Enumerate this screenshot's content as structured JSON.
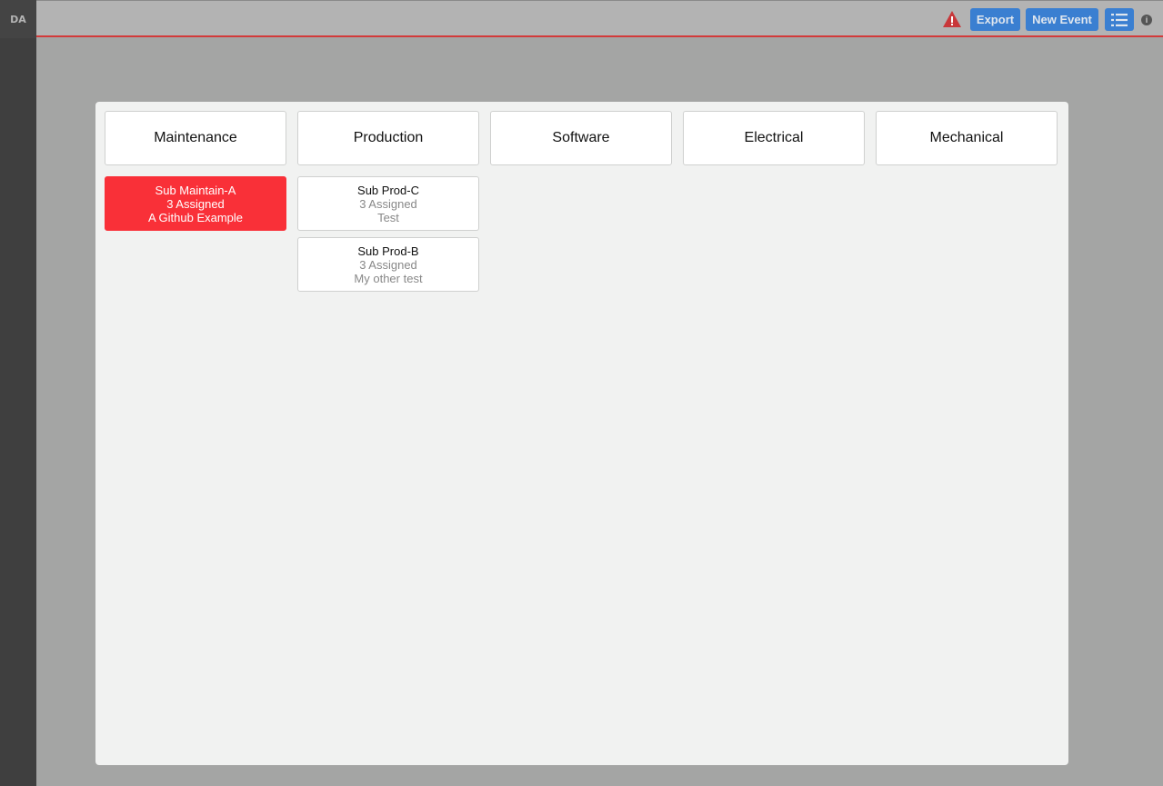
{
  "app": {
    "logo": "DA"
  },
  "toolbar": {
    "export_label": "Export",
    "new_event_label": "New Event",
    "info_label": "i"
  },
  "columns": [
    {
      "label": "Maintenance"
    },
    {
      "label": "Production"
    },
    {
      "label": "Software"
    },
    {
      "label": "Electrical"
    },
    {
      "label": "Mechanical"
    }
  ],
  "cards": [
    {
      "title": "Sub Maintain-A",
      "assigned": "3 Assigned",
      "description": "A Github Example",
      "status": "alert"
    },
    {
      "title": "Sub Prod-C",
      "assigned": "3 Assigned",
      "description": "Test",
      "status": "normal"
    },
    {
      "title": "Sub Prod-B",
      "assigned": "3 Assigned",
      "description": "My other test",
      "status": "normal"
    }
  ],
  "colors": {
    "alert": "#f93038",
    "accent": "#3a7fd1",
    "topbar_border": "#d33a3a"
  }
}
